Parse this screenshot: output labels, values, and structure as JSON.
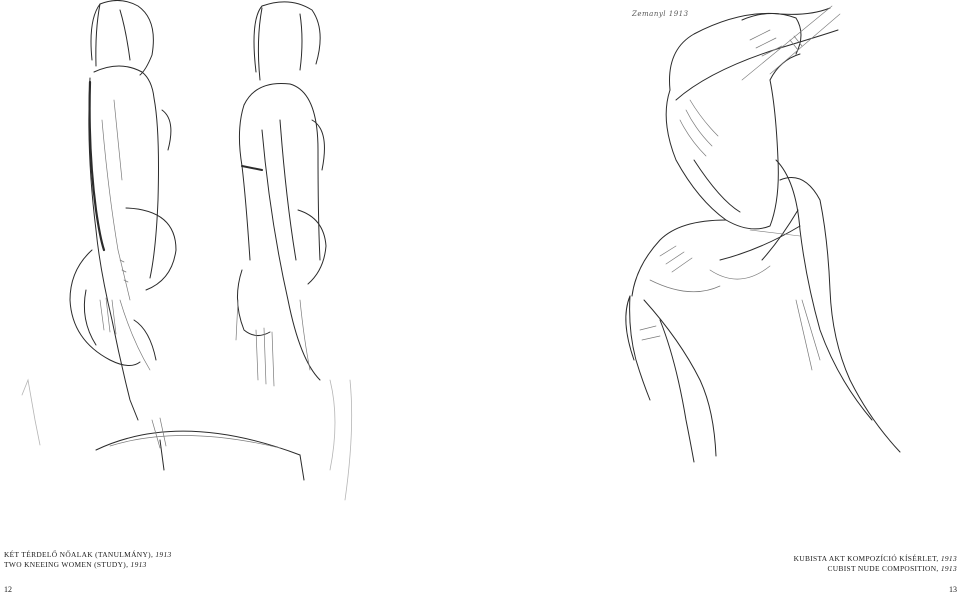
{
  "left_page": {
    "caption_line1_text": "Két térdelő nőalak (tanulmány), ",
    "caption_line1_year": "1913",
    "caption_line2_text": "Two kneeing women (study), ",
    "caption_line2_year": "1913",
    "page_number": "12"
  },
  "right_page": {
    "signature": "Zemanyl 1913",
    "caption_line1_text": "Kubista akt kompozíció kísérlet, ",
    "caption_line1_year": "1913",
    "caption_line2_text": "Cubist nude composition, ",
    "caption_line2_year": "1913",
    "page_number": "13"
  }
}
